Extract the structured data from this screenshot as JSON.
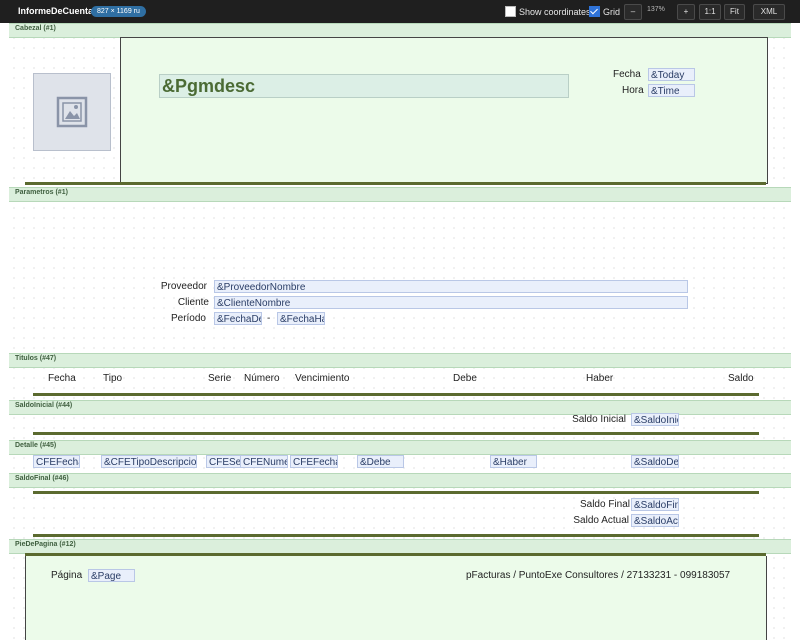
{
  "toolbar": {
    "title": "InformeDeCuenta",
    "dimensions": "827 × 1169 ru",
    "show_coordinates_label": "Show coordinates",
    "show_coordinates_checked": false,
    "grid_label": "Grid",
    "grid_checked": true,
    "zoom_out_label": "–",
    "zoom_value": "137%",
    "zoom_in_label": "+",
    "actual_size_label": "1:1",
    "fit_label": "Fit",
    "xml_label": "XML"
  },
  "bands": {
    "cabezal": "Cabezal (#1)",
    "parametros": "Parametros (#1)",
    "titulos": "Titulos (#47)",
    "saldo_inicial": "SaldoInicial (#44)",
    "detalle": "Detalle (#45)",
    "saldo_final": "SaldoFinal (#46)",
    "pie_de_pagina": "PieDePagina (#12)"
  },
  "cabezal": {
    "pgmdesc": "&Pgmdesc",
    "fecha_label": "Fecha",
    "fecha_field": "&Today",
    "hora_label": "Hora",
    "hora_field": "&Time",
    "image_icon": "image-placeholder-icon"
  },
  "parametros": {
    "proveedor_label": "Proveedor",
    "proveedor_field": "&ProveedorNombre",
    "cliente_label": "Cliente",
    "cliente_field": "&ClienteNombre",
    "periodo_label": "Período",
    "fecha_desde_field": "&FechaDe",
    "separator": "-",
    "fecha_hasta_field": "&FechaHa"
  },
  "titulos": {
    "fecha": "Fecha",
    "tipo": "Tipo",
    "serie": "Serie",
    "numero": "Número",
    "vencimiento": "Vencimiento",
    "debe": "Debe",
    "haber": "Haber",
    "saldo": "Saldo"
  },
  "saldo_inicial": {
    "label": "Saldo Inicial",
    "field": "&SaldoInic"
  },
  "detalle": {
    "cfe_fecha": "CFEFecha",
    "cfe_tipo": "&CFETipoDescripcio",
    "cfe_serie": "CFESerie",
    "cfe_numero": "CFENume",
    "cfe_vencimiento": "CFEFecha",
    "debe": "&Debe",
    "haber": "&Haber",
    "saldo": "&SaldoDe"
  },
  "saldo_final": {
    "final_label": "Saldo Final",
    "final_field": "&SaldoFin",
    "actual_label": "Saldo Actual",
    "actual_field": "&SaldoAct"
  },
  "pie_de_pagina": {
    "pagina_label": "Página",
    "page_field": "&Page",
    "footer_text": "pFacturas / PuntoExe Consultores / 27133231 - 099183057"
  }
}
